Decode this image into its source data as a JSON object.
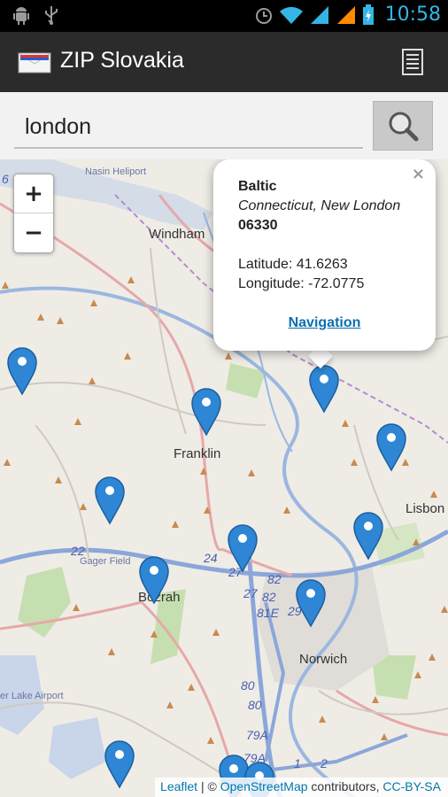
{
  "status_bar": {
    "time": "10:58",
    "icons": [
      "android-debug-icon",
      "usb-icon",
      "alarm-icon",
      "wifi-icon",
      "signal-icon",
      "signal-icon",
      "battery-icon"
    ]
  },
  "action_bar": {
    "title": "ZIP Slovakia",
    "logo_icon": "envelope-icon",
    "menu_icon": "list-menu-icon"
  },
  "search": {
    "value": "london",
    "button_icon": "magnifier-icon"
  },
  "map": {
    "zoom_in": "+",
    "zoom_out": "−",
    "labels": {
      "windham": "Windham",
      "franklin": "Franklin",
      "bozrah": "Bozrah",
      "norwich": "Norwich",
      "lisbon": "Lisbon",
      "heliport": "Nasin Heliport",
      "gager_field": "Gager Field",
      "airport": "er Lake Airport"
    },
    "route_numbers": [
      "22",
      "24",
      "27",
      "27",
      "82",
      "82",
      "81E",
      "29",
      "80",
      "80",
      "79A",
      "79A",
      "1",
      "2",
      "6"
    ],
    "popup": {
      "name": "Baltic",
      "region": "Connecticut, New London",
      "zip": "06330",
      "latitude": "Latitude: 41.6263",
      "longitude": "Longitude: -72.0775",
      "navigation": "Navigation",
      "close": "×"
    },
    "attribution": {
      "leaflet": "Leaflet",
      "sep": " | © ",
      "osm": "OpenStreetMap",
      "contributors": " contributors, ",
      "license": "CC-BY-SA"
    },
    "marker_color": "#2e86d4"
  }
}
